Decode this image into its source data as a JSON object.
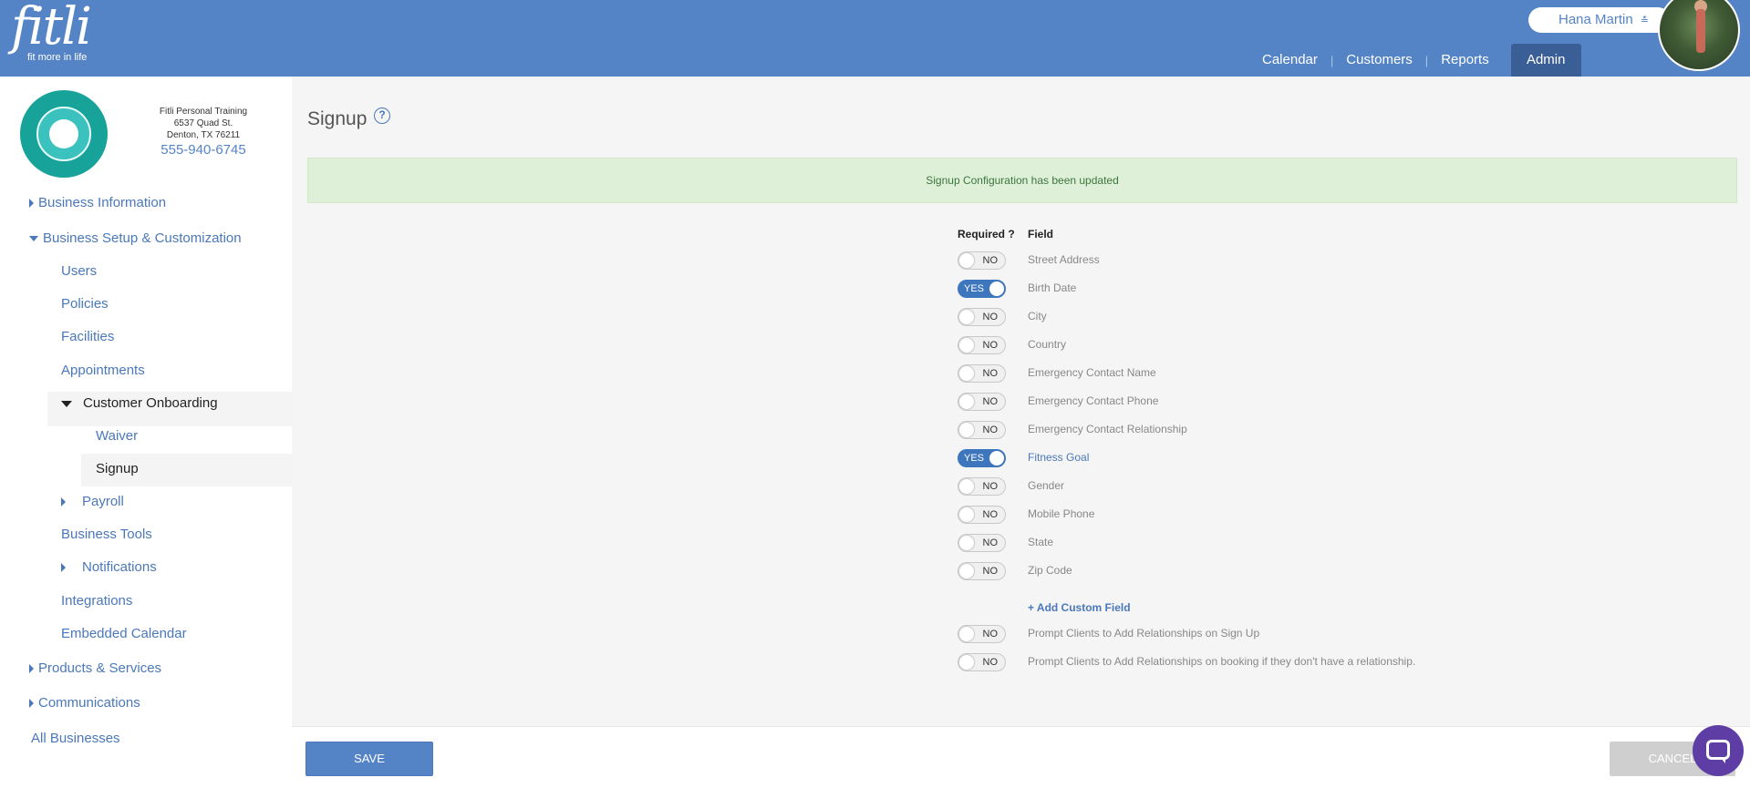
{
  "header": {
    "logo_word": "fitli",
    "logo_tagline": "fit more in life",
    "user_name": "Hana Martin",
    "nav": [
      {
        "label": "Calendar"
      },
      {
        "label": "Customers"
      },
      {
        "label": "Reports"
      },
      {
        "label": "Admin",
        "active": true
      }
    ]
  },
  "business": {
    "name": "Fitli Personal Training",
    "address1": "6537 Quad St.",
    "address2": "Denton, TX 76211",
    "phone": "555-940-6745"
  },
  "sidebar": {
    "business_information": "Business Information",
    "business_setup": "Business Setup & Customization",
    "users": "Users",
    "policies": "Policies",
    "facilities": "Facilities",
    "appointments": "Appointments",
    "customer_onboarding": "Customer Onboarding",
    "waiver": "Waiver",
    "signup": "Signup",
    "payroll": "Payroll",
    "business_tools": "Business Tools",
    "notifications": "Notifications",
    "integrations": "Integrations",
    "embedded_calendar": "Embedded Calendar",
    "products_services": "Products & Services",
    "communications": "Communications",
    "all_businesses": "All Businesses"
  },
  "main": {
    "title": "Signup",
    "help": "?",
    "alert": "Signup Configuration has been updated",
    "col_required": "Required ?",
    "col_field": "Field",
    "fields": [
      {
        "state": "NO",
        "label": "Street Address"
      },
      {
        "state": "YES",
        "label": "Birth Date"
      },
      {
        "state": "NO",
        "label": "City"
      },
      {
        "state": "NO",
        "label": "Country"
      },
      {
        "state": "NO",
        "label": "Emergency Contact Name"
      },
      {
        "state": "NO",
        "label": "Emergency Contact Phone"
      },
      {
        "state": "NO",
        "label": "Emergency Contact Relationship"
      },
      {
        "state": "YES",
        "label": "Fitness Goal"
      },
      {
        "state": "NO",
        "label": "Gender"
      },
      {
        "state": "NO",
        "label": "Mobile Phone"
      },
      {
        "state": "NO",
        "label": "State"
      },
      {
        "state": "NO",
        "label": "Zip Code"
      }
    ],
    "add_custom_field": "+ Add Custom Field",
    "prompts": [
      {
        "state": "NO",
        "label": "Prompt Clients to Add Relationships on Sign Up"
      },
      {
        "state": "NO",
        "label": "Prompt Clients to Add Relationships on booking if they don't have a relationship."
      }
    ]
  },
  "footer": {
    "save": "SAVE",
    "cancel": "CANCEL"
  },
  "colors": {
    "brand": "#5584c6",
    "toggle_on": "#3e76be",
    "alert_bg": "#dff0d8",
    "chat": "#5e3ea5"
  }
}
